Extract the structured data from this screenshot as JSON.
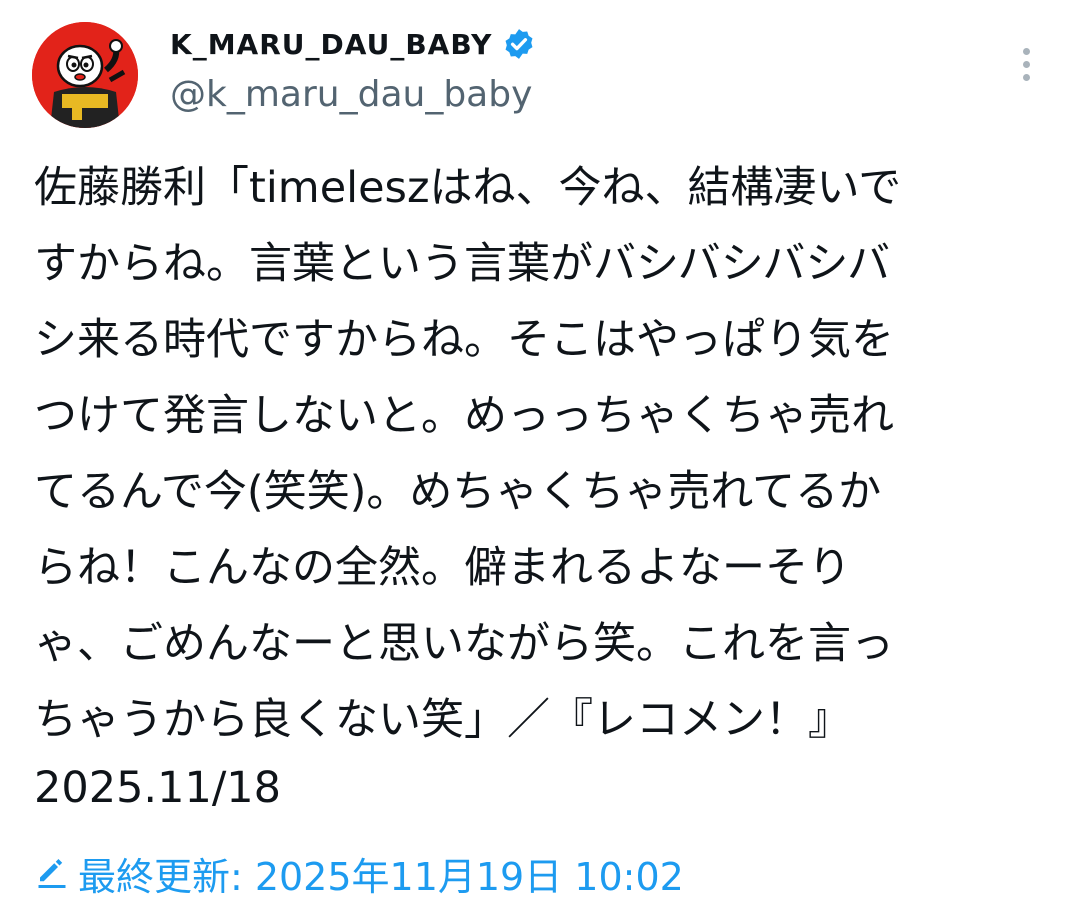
{
  "colors": {
    "avatar_bg": "#e2231a",
    "verified_badge": "#1d9bf0",
    "link_blue": "#1d9bf0",
    "handle_gray": "#536471",
    "text": "#0f1419"
  },
  "author": {
    "display_name": "K_MARU_DAU_BABY",
    "handle": "@k_maru_dau_baby",
    "verified": true,
    "avatar_icon": "cartoon-mascot-avatar"
  },
  "menu": {
    "icon": "more-vertical-icon"
  },
  "tweet": {
    "lines": [
      "佐藤勝利「timeleszはね、今ね、結構凄いで",
      "すからね。言葉という言葉がバシバシバシバ",
      "シ来る時代ですからね。そこはやっぱり気を",
      "つけて発言しないと。めっっちゃくちゃ売れ",
      "てるんで今(笑笑)。めちゃくちゃ売れてるか",
      "らね！こんなの全然。僻まれるよなーそり",
      "ゃ、ごめんなーと思いながら笑。これを言っ",
      "ちゃうから良くない笑」／『レコメン！』"
    ],
    "date_text": "2025.11/18"
  },
  "edit_info": {
    "icon": "pencil-icon",
    "label": "最終更新:",
    "timestamp": "2025年11月19日 10:02"
  }
}
